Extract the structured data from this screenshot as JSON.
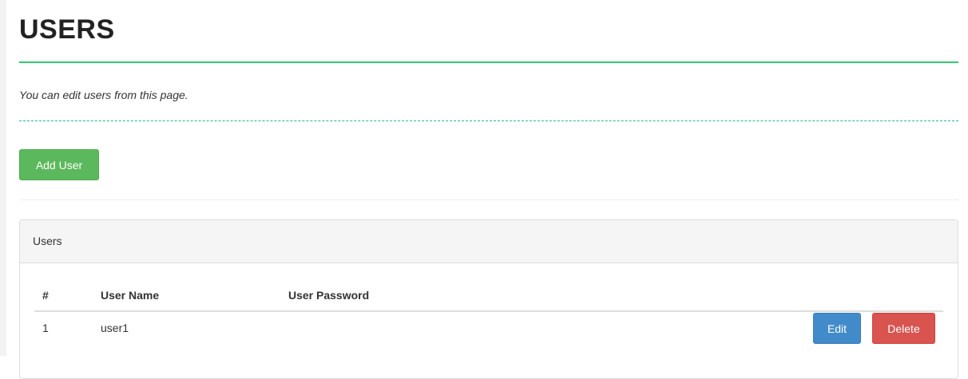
{
  "page": {
    "title": "USERS",
    "subtitle": "You can edit users from this page."
  },
  "toolbar": {
    "add_user_label": "Add User"
  },
  "panel": {
    "heading": "Users",
    "columns": [
      "#",
      "User Name",
      "User Password",
      ""
    ],
    "rows": [
      {
        "num": "1",
        "name": "user1",
        "password": "",
        "edit_label": "Edit",
        "delete_label": "Delete"
      }
    ]
  },
  "colors": {
    "accent": "#2ecc71",
    "dashed_divider": "#1abc9c",
    "add_button": "#5cb85c",
    "edit_button": "#428bca",
    "delete_button": "#d9534f"
  }
}
